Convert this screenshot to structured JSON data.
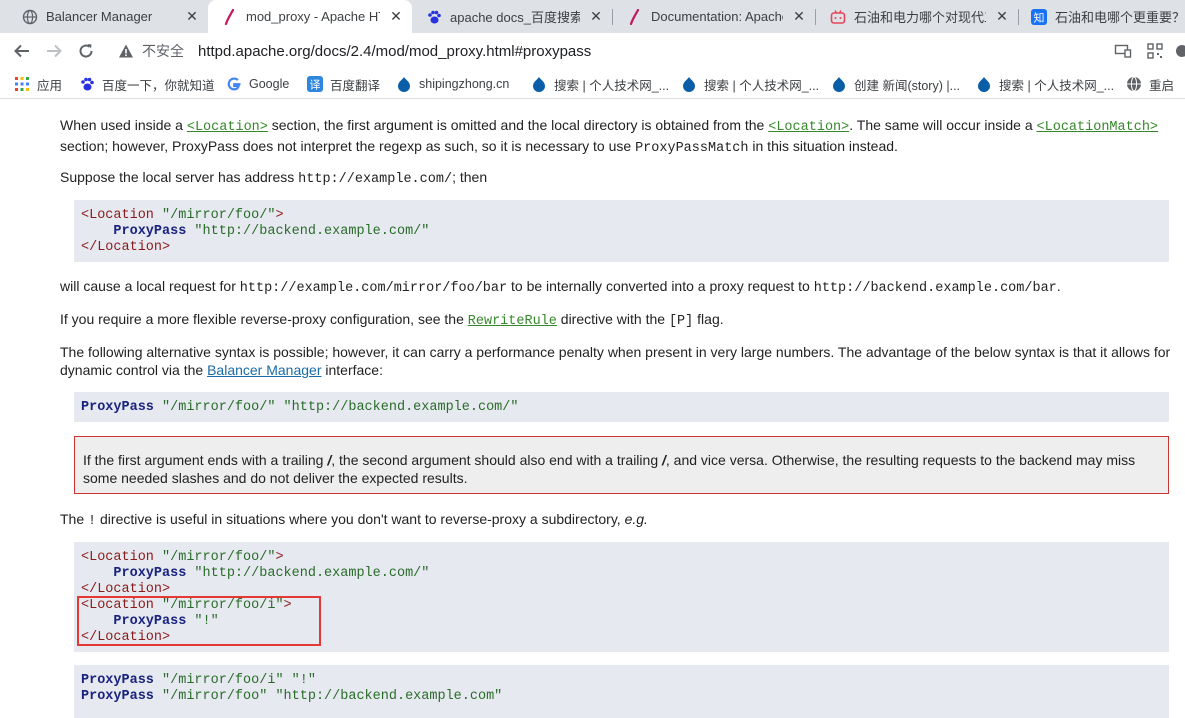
{
  "browser": {
    "tabs": [
      {
        "title": "Balancer Manager",
        "icon": "globe-icon",
        "active": false
      },
      {
        "title": "mod_proxy - Apache HTTP",
        "icon": "apache-feather-icon",
        "active": true
      },
      {
        "title": "apache docs_百度搜索",
        "icon": "baidu-paw-icon",
        "active": false
      },
      {
        "title": "Documentation: Apache",
        "icon": "apache-feather-icon",
        "active": false
      },
      {
        "title": "石油和电力哪个对现代工业",
        "icon": "bilibili-icon",
        "active": false
      },
      {
        "title": "石油和电哪个更重要？ -",
        "icon": "zhihu-icon",
        "active": false
      }
    ],
    "address": {
      "insecure_label": "不安全",
      "url": "httpd.apache.org/docs/2.4/mod/mod_proxy.html#proxypass"
    },
    "bookmarks": [
      {
        "label": "应用",
        "icon": "apps-grid-icon"
      },
      {
        "label": "百度一下，你就知道",
        "icon": "baidu-paw-icon"
      },
      {
        "label": "Google",
        "icon": "google-icon"
      },
      {
        "label": "百度翻译",
        "icon": "translate-icon"
      },
      {
        "label": "shipingzhong.cn",
        "icon": "drupal-icon"
      },
      {
        "label": "搜索 | 个人技术网_...",
        "icon": "drupal-icon"
      },
      {
        "label": "搜索 | 个人技术网_...",
        "icon": "drupal-icon"
      },
      {
        "label": "创建 新闻(story) |...",
        "icon": "drupal-icon"
      },
      {
        "label": "搜索 | 个人技术网_...",
        "icon": "drupal-icon"
      },
      {
        "label": "重启",
        "icon": "globe-icon"
      }
    ]
  },
  "doc": {
    "p1": {
      "a": "When used inside a ",
      "loc1": "<Location>",
      "b": " section, the first argument is omitted and the local directory is obtained from the ",
      "loc2": "<Location>",
      "c": ". The same will occur inside a ",
      "locmatch": "<LocationMatch>",
      "d": " section; however, ProxyPass does not interpret the regexp as such, so it is necessary to use ",
      "ppm": "ProxyPassMatch",
      "e": " in this situation instead."
    },
    "p2": {
      "a": "Suppose the local server has address ",
      "code": "http://example.com/",
      "b": "; then"
    },
    "code1": {
      "l1_tag": "<Location",
      "l1_str": " \"/mirror/foo/\"",
      "l1_end": ">",
      "l2_kw": "ProxyPass",
      "l2_str": " \"http://backend.example.com/\"",
      "l3_tag": "</Location>"
    },
    "p3": {
      "a": "will cause a local request for ",
      "code1": "http://example.com/mirror/foo/bar",
      "b": " to be internally converted into a proxy request to ",
      "code2": "http://backend.example.com/bar",
      "c": "."
    },
    "p4": {
      "a": "If you require a more flexible reverse-proxy configuration, see the ",
      "link": "RewriteRule",
      "b": " directive with the ",
      "code": "[P]",
      "c": " flag."
    },
    "p5": {
      "a": "The following alternative syntax is possible; however, it can carry a performance penalty when present in very large numbers. The advantage of the below syntax is that it allows for dynamic control via the ",
      "link": "Balancer Manager",
      "b": " interface:"
    },
    "code2": {
      "kw": "ProxyPass",
      "str": " \"/mirror/foo/\" \"http://backend.example.com/\""
    },
    "warning": {
      "a": "If the first argument ends with a trailing ",
      "slash1": "/",
      "b": ", the second argument should also end with a trailing ",
      "slash2": "/",
      "c": ", and vice versa. Otherwise, the resulting requests to the backend may miss some needed slashes and do not deliver the expected results."
    },
    "p6": {
      "a": "The ",
      "code": "!",
      "b": " directive is useful in situations where you don't want to reverse-proxy a subdirectory, ",
      "eg": "e.g."
    },
    "code3": {
      "l1_tag": "<Location",
      "l1_str": " \"/mirror/foo/\"",
      "l1_end": ">",
      "l2_kw": "ProxyPass",
      "l2_str": " \"http://backend.example.com/\"",
      "l3_tag": "</Location>",
      "l4_tag": "<Location",
      "l4_str": " \"/mirror/foo/i\"",
      "l4_end": ">",
      "l5_kw": "ProxyPass",
      "l5_str": " \"!\"",
      "l6_tag": "</Location>"
    },
    "code4": {
      "l1_kw": "ProxyPass",
      "l1_str": " \"/mirror/foo/i\" \"!\"",
      "l2_kw": "ProxyPass",
      "l2_str": " \"/mirror/foo\" \"http://backend.example.com\""
    }
  },
  "colors": {
    "highlight_box": "#e53935",
    "directive_link": "#35892a",
    "link": "#1a6ba6"
  }
}
